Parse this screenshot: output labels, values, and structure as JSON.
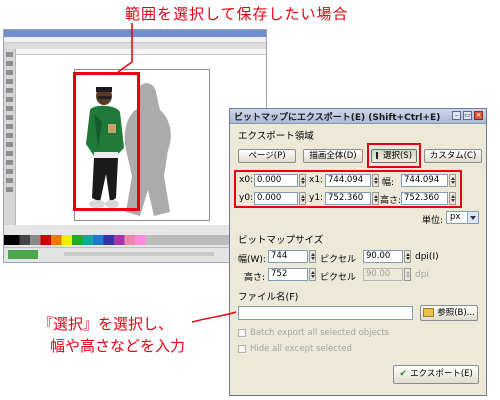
{
  "annotations": {
    "top": "範囲を選択して保存したい場合",
    "bottom_line1": "『選択』を選択し、",
    "bottom_line2": "幅や高さなどを入力"
  },
  "dialog": {
    "title": "ビットマップにエクスポート(E) (Shift+Ctrl+E)",
    "export_area_label": "エクスポート領域",
    "area_buttons": {
      "page": "ページ(P)",
      "drawing": "描画全体(D)",
      "selection": "選択(S)",
      "custom": "カスタム(C)"
    },
    "coords": {
      "x0_label": "x0:",
      "x0_value": "0.000",
      "x1_label": "x1:",
      "x1_value": "744.094",
      "width_label": "幅:",
      "width_value": "744.094",
      "y0_label": "y0:",
      "y0_value": "0.000",
      "y1_label": "y1:",
      "y1_value": "752.360",
      "height_label": "高さ:",
      "height_value": "752.360"
    },
    "units_label": "単位:",
    "units_value": "px",
    "bitmap_size_label": "ビットマップサイズ",
    "bitmap": {
      "width_label": "幅(W):",
      "width_value": "744",
      "pixel_label": "ピクセル",
      "dpi_value": "90.00",
      "dpi_label": "dpi(I)",
      "height_label": "高さ:",
      "height_value": "752",
      "pixel_label2": "ピクセル",
      "dpi_value2": "90.00",
      "dpi_label2": "dpi"
    },
    "filename_label": "ファイル名(F)",
    "filename_value": "",
    "browse_button": "参照(B)...",
    "batch_export": "Batch export all selected objects",
    "hide_all": "Hide all except selected",
    "export_button": "エクスポート(E)"
  }
}
